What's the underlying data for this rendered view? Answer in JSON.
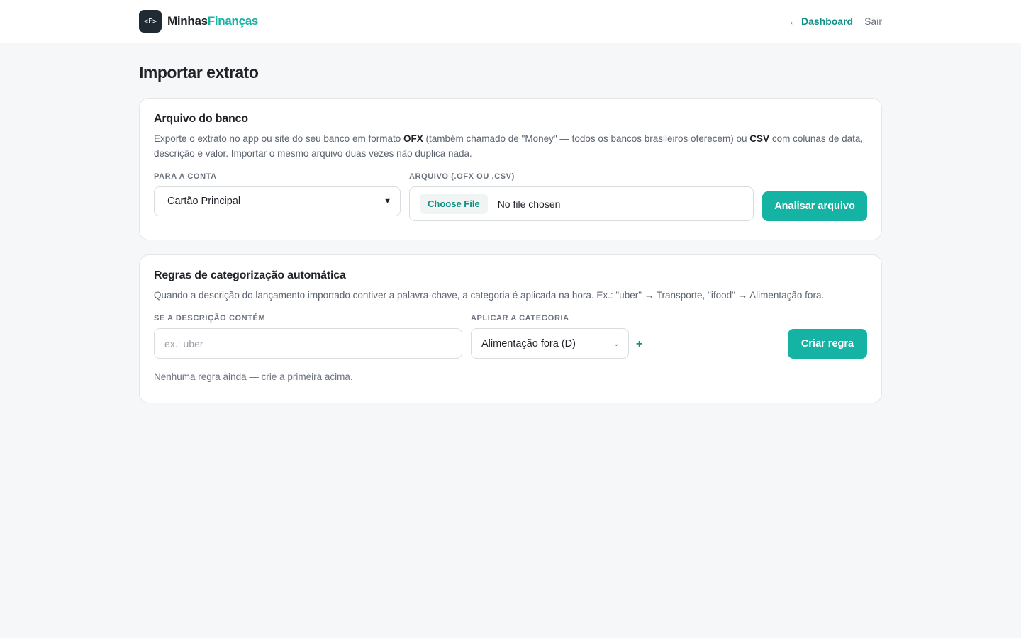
{
  "header": {
    "logo_text": "<F>",
    "brand_part1": "Minhas",
    "brand_part2": "Finanças",
    "nav_dashboard": "← Dashboard",
    "nav_logout": "Sair"
  },
  "page": {
    "title": "Importar extrato"
  },
  "import_card": {
    "title": "Arquivo do banco",
    "desc_1": "Exporte o extrato no app ou site do seu banco em formato ",
    "desc_ofx": "OFX",
    "desc_2": " (também chamado de \"Money\" — todos os bancos brasileiros oferecem) ou ",
    "desc_csv": "CSV",
    "desc_3": " com colunas de data, descrição e valor. Importar o mesmo arquivo duas vezes não duplica nada.",
    "account_label": "Para a conta",
    "account_value": "Cartão Principal",
    "file_label": "Arquivo (.ofx ou .csv)",
    "choose_file": "Choose File",
    "no_file": "No file chosen",
    "analyze_button": "Analisar arquivo"
  },
  "rules_card": {
    "title": "Regras de categorização automática",
    "desc": "Quando a descrição do lançamento importado contiver a palavra-chave, a categoria é aplicada na hora. Ex.: \"uber\" → Transporte, \"ifood\" → Alimentação fora.",
    "contains_label": "Se a descrição contém",
    "contains_placeholder": "ex.: uber",
    "category_label": "Aplicar a categoria",
    "category_value": "Alimentação fora (D)",
    "add_category": "+",
    "create_button": "Criar regra",
    "empty_message": "Nenhuma regra ainda — crie a primeira acima."
  },
  "colors": {
    "accent": "#14b3a3",
    "accent_dark": "#0f8f83",
    "background": "#f5f7f8"
  },
  "icons": {
    "select_arrow": "chevron-down-icon",
    "add": "plus-icon"
  }
}
